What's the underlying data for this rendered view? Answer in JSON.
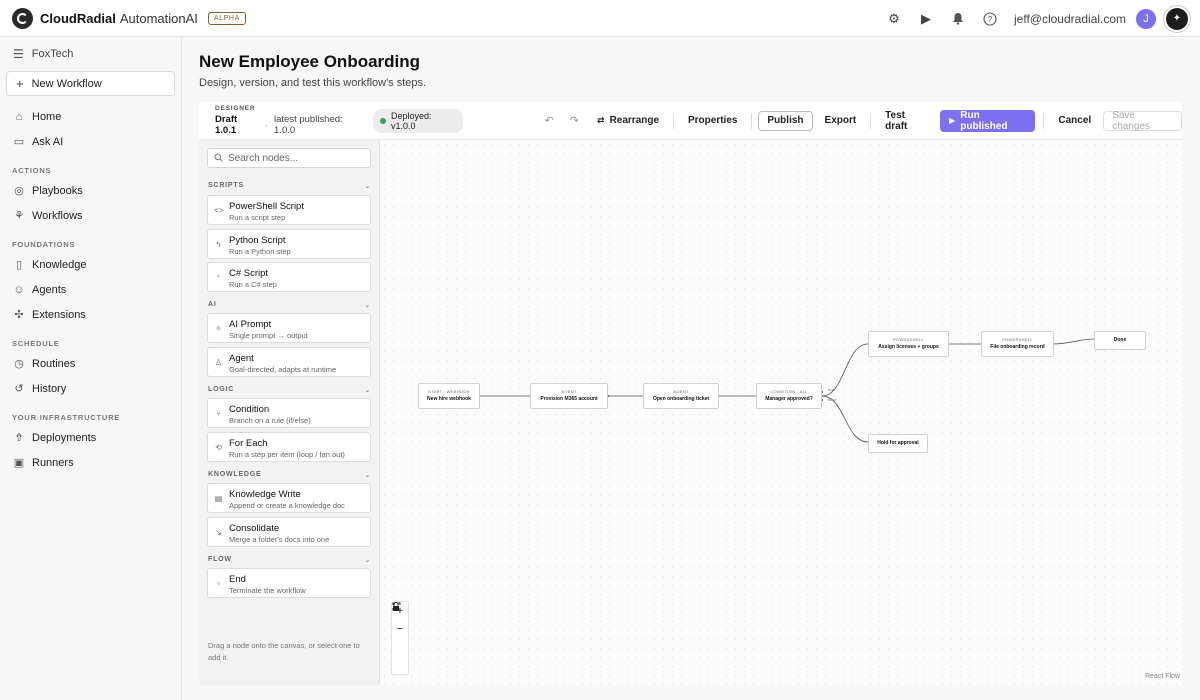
{
  "app": {
    "brand": "CloudRadial",
    "product": "AutomationAI",
    "badge": "ALPHA",
    "user_email": "jeff@cloudradial.com",
    "avatar_initial": "J"
  },
  "sidebar": {
    "org": "FoxTech",
    "new_workflow": "New Workflow",
    "top_items": [
      {
        "label": "Home",
        "icon": "home-icon"
      },
      {
        "label": "Ask AI",
        "icon": "chat-icon"
      }
    ],
    "sections": [
      {
        "title": "ACTIONS",
        "items": [
          {
            "label": "Playbooks",
            "icon": "playbook-icon"
          },
          {
            "label": "Workflows",
            "icon": "workflow-icon"
          }
        ]
      },
      {
        "title": "FOUNDATIONS",
        "items": [
          {
            "label": "Knowledge",
            "icon": "book-icon"
          },
          {
            "label": "Agents",
            "icon": "bot-icon"
          },
          {
            "label": "Extensions",
            "icon": "puzzle-icon"
          }
        ]
      },
      {
        "title": "SCHEDULE",
        "items": [
          {
            "label": "Routines",
            "icon": "clock-icon"
          },
          {
            "label": "History",
            "icon": "history-icon"
          }
        ]
      },
      {
        "title": "YOUR INFRASTRUCTURE",
        "items": [
          {
            "label": "Deployments",
            "icon": "rocket-icon"
          },
          {
            "label": "Runners",
            "icon": "runner-icon"
          }
        ]
      }
    ]
  },
  "page": {
    "title": "New Employee Onboarding",
    "subtitle": "Design, version, and test this workflow's steps."
  },
  "toolbar": {
    "designer_label": "DESIGNER",
    "draft": "Draft 1.0.1",
    "separator": "·",
    "latest": "latest published: 1.0.0",
    "deployed": "Deployed: v1.0.0",
    "rearrange": "Rearrange",
    "properties": "Properties",
    "publish": "Publish",
    "export": "Export",
    "test_draft": "Test draft",
    "run_published": "Run published",
    "cancel": "Cancel",
    "save_changes": "Save changes"
  },
  "palette": {
    "search_placeholder": "Search nodes...",
    "sections": [
      {
        "title": "SCRIPTS",
        "nodes": [
          {
            "title": "PowerShell Script",
            "sub": "Run a script step",
            "icon": "code-icon"
          },
          {
            "title": "Python Script",
            "sub": "Run a Python step",
            "icon": "python-icon"
          },
          {
            "title": "C# Script",
            "sub": "Run a C# step",
            "icon": "csharp-icon"
          }
        ]
      },
      {
        "title": "AI",
        "nodes": [
          {
            "title": "AI Prompt",
            "sub": "Single prompt → output",
            "icon": "sparkle-icon"
          },
          {
            "title": "Agent",
            "sub": "Goal-directed, adapts at runtime",
            "icon": "agent-icon"
          }
        ]
      },
      {
        "title": "LOGIC",
        "nodes": [
          {
            "title": "Condition",
            "sub": "Branch on a rule (if/else)",
            "icon": "branch-icon"
          },
          {
            "title": "For Each",
            "sub": "Run a step per item (loop / fan out)",
            "icon": "loop-icon"
          }
        ]
      },
      {
        "title": "KNOWLEDGE",
        "nodes": [
          {
            "title": "Knowledge Write",
            "sub": "Append or create a knowledge doc",
            "icon": "doc-icon"
          },
          {
            "title": "Consolidate",
            "sub": "Merge a folder's docs into one",
            "icon": "merge-icon"
          }
        ]
      },
      {
        "title": "FLOW",
        "nodes": [
          {
            "title": "End",
            "sub": "Terminate the workflow",
            "icon": "stop-icon"
          }
        ]
      }
    ],
    "help": "Drag a node onto the canvas, or select one to add it."
  },
  "canvas": {
    "nodes": [
      {
        "kind": "START · WEBHOOK",
        "title": "New hire webhook"
      },
      {
        "kind": "AGENT",
        "title": "Provision M365 account"
      },
      {
        "kind": "AGENT",
        "title": "Open onboarding ticket"
      },
      {
        "kind": "CONDITION · ALL",
        "title": "Manager approved?"
      },
      {
        "kind": "POWERSHELL",
        "title": "Assign licenses + groups"
      },
      {
        "kind": "POWERSHELL",
        "title": "File onboarding record"
      },
      {
        "kind": "",
        "title": "Done"
      },
      {
        "kind": "",
        "title": "Hold for approval"
      }
    ],
    "edge_true": "true",
    "edge_false": "false",
    "zoom_in": "+",
    "zoom_out": "−",
    "attribution": "React Flow"
  }
}
